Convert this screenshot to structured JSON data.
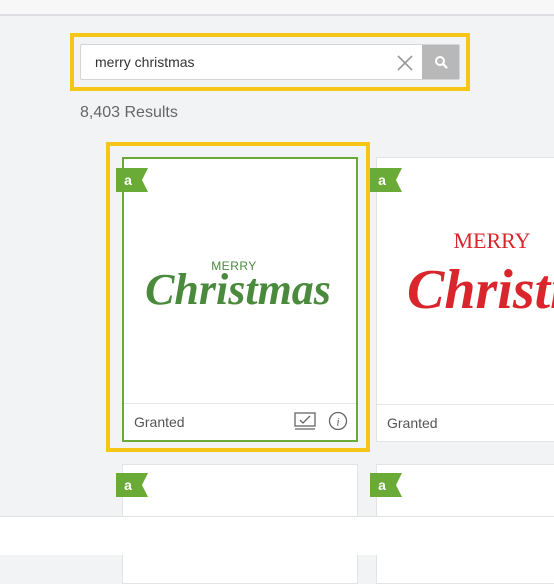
{
  "search": {
    "query": "merry christmas",
    "clear_icon": "close-icon",
    "search_icon": "search-icon"
  },
  "results": {
    "count_label": "8,403 Results"
  },
  "cards": [
    {
      "art_line1": "MERRY",
      "art_line2": "Christmas",
      "color": "#4a8a3c",
      "status": "Granted",
      "selected": true
    },
    {
      "art_line1": "MERRY",
      "art_line2": "Christmas",
      "color": "#d9262c",
      "status": "Granted",
      "selected": false
    },
    {
      "status": "",
      "selected": false
    },
    {
      "status": "",
      "selected": false
    }
  ],
  "badge": {
    "letter": "a",
    "color": "#6aab37"
  },
  "colors": {
    "highlight": "#f5c518",
    "accent": "#6aab37"
  }
}
